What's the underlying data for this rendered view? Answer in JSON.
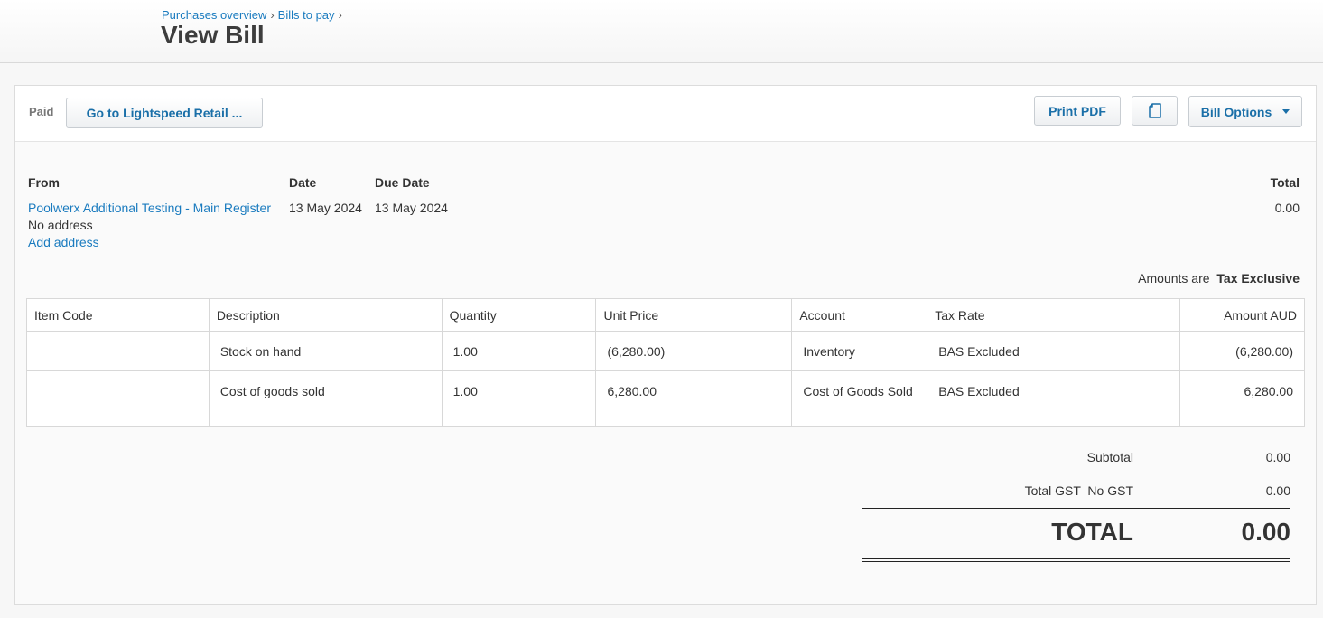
{
  "breadcrumb": {
    "item1": "Purchases overview",
    "item2": "Bills to pay",
    "sep": "›"
  },
  "page": {
    "title": "View Bill"
  },
  "toolbar": {
    "status": "Paid",
    "lightspeed_button": "Go to Lightspeed Retail ...",
    "print_pdf": "Print PDF",
    "copy_icon": "copy-document-icon",
    "bill_options": "Bill Options"
  },
  "bill": {
    "from_label": "From",
    "date_label": "Date",
    "due_date_label": "Due Date",
    "total_label": "Total",
    "from_name": "Poolwerx Additional Testing - Main Register",
    "address": "No address",
    "add_address": "Add address",
    "date": "13 May 2024",
    "due_date": "13 May 2024",
    "total": "0.00",
    "amounts_are_label": "Amounts are",
    "amounts_are_value": "Tax Exclusive"
  },
  "table": {
    "headers": [
      "Item Code",
      "Description",
      "Quantity",
      "Unit Price",
      "Account",
      "Tax Rate",
      "Amount AUD"
    ],
    "rows": [
      {
        "item_code": "",
        "description": "Stock on hand",
        "quantity": "1.00",
        "unit_price": "(6,280.00)",
        "account": "Inventory",
        "tax_rate": "BAS Excluded",
        "amount": "(6,280.00)"
      },
      {
        "item_code": "",
        "description": "Cost of goods sold",
        "quantity": "1.00",
        "unit_price": "6,280.00",
        "account": "Cost of Goods Sold",
        "tax_rate": "BAS Excluded",
        "amount": "6,280.00"
      }
    ]
  },
  "totals": {
    "subtotal_label": "Subtotal",
    "subtotal": "0.00",
    "gst_label": "Total GST  No GST",
    "gst": "0.00",
    "total_label": "TOTAL",
    "total": "0.00"
  },
  "colors": {
    "link": "#1a7bbf",
    "button_text": "#1a6fa8"
  }
}
